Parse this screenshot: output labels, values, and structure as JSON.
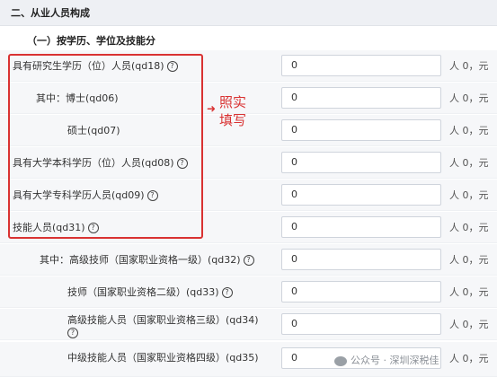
{
  "section": {
    "title": "二、从业人员构成"
  },
  "subsection": {
    "title": "（一）按学历、学位及技能分"
  },
  "annotation": {
    "arrow": "➜",
    "text": "照实填写"
  },
  "help_icon_glyph": "?",
  "rows": [
    {
      "label": "具有研究生学历（位）人员(qd18)",
      "value": "0",
      "unit": "人 0，元"
    },
    {
      "label": "其中：博士(qd06)",
      "value": "0",
      "unit": "人 0，元"
    },
    {
      "label": "硕士(qd07)",
      "value": "0",
      "unit": "人 0，元"
    },
    {
      "label": "具有大学本科学历（位）人员(qd08)",
      "value": "0",
      "unit": "人 0，元"
    },
    {
      "label": "具有大学专科学历人员(qd09)",
      "value": "0",
      "unit": "人 0，元"
    },
    {
      "label": "技能人员(qd31)",
      "value": "0",
      "unit": "人 0，元"
    },
    {
      "label": "其中：高级技师（国家职业资格一级）(qd32)",
      "value": "0",
      "unit": "人 0，元"
    },
    {
      "label": "技师（国家职业资格二级）(qd33)",
      "value": "0",
      "unit": "人 0，元"
    },
    {
      "label": "高级技能人员（国家职业资格三级）(qd34)",
      "value": "0",
      "unit": "人 0，元"
    },
    {
      "label": "中级技能人员（国家职业资格四级）(qd35)",
      "value": "0",
      "unit": "人 0，元"
    }
  ],
  "watermark": {
    "text": "公众号 · 深圳深税佳"
  }
}
